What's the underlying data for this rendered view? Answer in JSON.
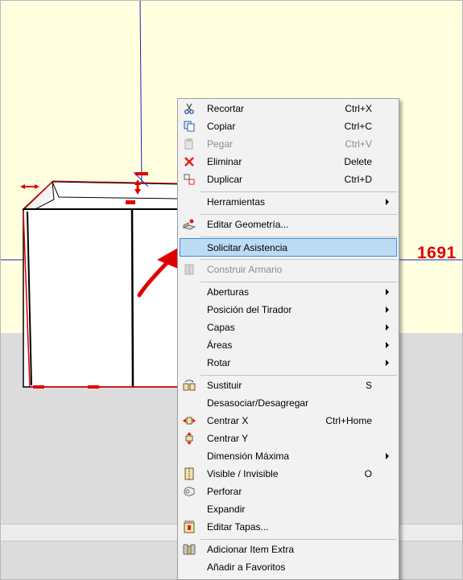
{
  "dimension_label": "1691",
  "menu": {
    "items": [
      {
        "id": "recortar",
        "label": "Recortar",
        "shortcut": "Ctrl+X",
        "icon": "scissors-icon"
      },
      {
        "id": "copiar",
        "label": "Copiar",
        "shortcut": "Ctrl+C",
        "icon": "copy-icon"
      },
      {
        "id": "pegar",
        "label": "Pegar",
        "shortcut": "Ctrl+V",
        "icon": "paste-icon",
        "disabled": true
      },
      {
        "id": "eliminar",
        "label": "Eliminar",
        "shortcut": "Delete",
        "icon": "delete-x-icon"
      },
      {
        "id": "duplicar",
        "label": "Duplicar",
        "shortcut": "Ctrl+D",
        "icon": "duplicate-icon"
      },
      {
        "id": "herramientas",
        "label": "Herramientas",
        "submenu": true
      },
      {
        "id": "editar-geometria",
        "label": "Editar Geometría...",
        "icon": "edit-geometry-icon"
      },
      {
        "id": "solicitar-asistencia",
        "label": "Solicitar Asistencia",
        "highlighted": true
      },
      {
        "id": "construir-armario",
        "label": "Construir Armario",
        "icon": "wardrobe-icon",
        "disabled": true
      },
      {
        "id": "aberturas",
        "label": "Aberturas",
        "submenu": true
      },
      {
        "id": "posicion-tirador",
        "label": "Posición del Tirador",
        "submenu": true
      },
      {
        "id": "capas",
        "label": "Capas",
        "submenu": true
      },
      {
        "id": "areas",
        "label": "Áreas",
        "submenu": true
      },
      {
        "id": "rotar",
        "label": "Rotar",
        "submenu": true
      },
      {
        "id": "sustituir",
        "label": "Sustituir",
        "shortcut": "S",
        "icon": "replace-icon"
      },
      {
        "id": "desasociar",
        "label": "Desasociar/Desagregar"
      },
      {
        "id": "centrar-x",
        "label": "Centrar X",
        "shortcut": "Ctrl+Home",
        "icon": "center-x-icon"
      },
      {
        "id": "centrar-y",
        "label": "Centrar Y",
        "icon": "center-y-icon"
      },
      {
        "id": "dimension-maxima",
        "label": "Dimensión Máxima",
        "submenu": true
      },
      {
        "id": "visible-invisible",
        "label": "Visible / Invisible",
        "shortcut": "O",
        "icon": "visibility-icon"
      },
      {
        "id": "perforar",
        "label": "Perforar",
        "icon": "drill-icon"
      },
      {
        "id": "expandir",
        "label": "Expandir"
      },
      {
        "id": "editar-tapas",
        "label": "Editar Tapas...",
        "icon": "edit-edges-icon"
      },
      {
        "id": "adicionar-item",
        "label": "Adicionar Item Extra",
        "icon": "add-extra-item-icon"
      },
      {
        "id": "anadir-favoritos",
        "label": "Añadir a Favoritos"
      }
    ]
  }
}
